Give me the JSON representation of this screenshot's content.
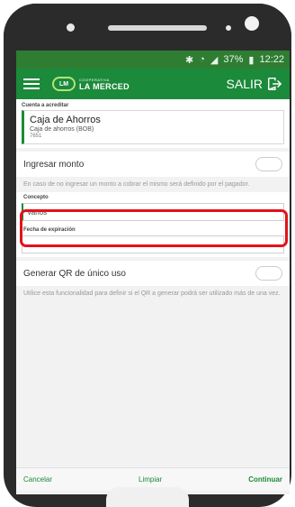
{
  "status": {
    "battery": "37%",
    "time": "12:22"
  },
  "header": {
    "brand_small": "COOPERATIVA",
    "brand_mark": "LM",
    "brand_name": "LA MERCED",
    "logout_label": "SALIR"
  },
  "account": {
    "section_label": "Cuenta a acreditar",
    "title": "Caja de Ahorros",
    "subtitle": "Caja de ahorros (BOB)",
    "number": "7651"
  },
  "amount_toggle": {
    "label": "Ingresar monto",
    "enabled": false
  },
  "amount_hint": "En caso de no ingresar un monto a cobrar el mismo será definido por el pagador.",
  "concepto": {
    "label": "Concepto",
    "value": "Varios"
  },
  "expiration": {
    "label": "Fecha de expiración",
    "value": ""
  },
  "single_use_toggle": {
    "label": "Generar QR de único uso",
    "enabled": false
  },
  "single_use_hint": "Utilice esta funcionalidad para definir si el QR a generar podrá ser utilizado más de una vez.",
  "footer": {
    "cancel": "Cancelar",
    "clear": "Limpiar",
    "continue": "Continuar"
  },
  "colors": {
    "brand_green": "#1b8a3a",
    "highlight_red": "#e3121b"
  }
}
